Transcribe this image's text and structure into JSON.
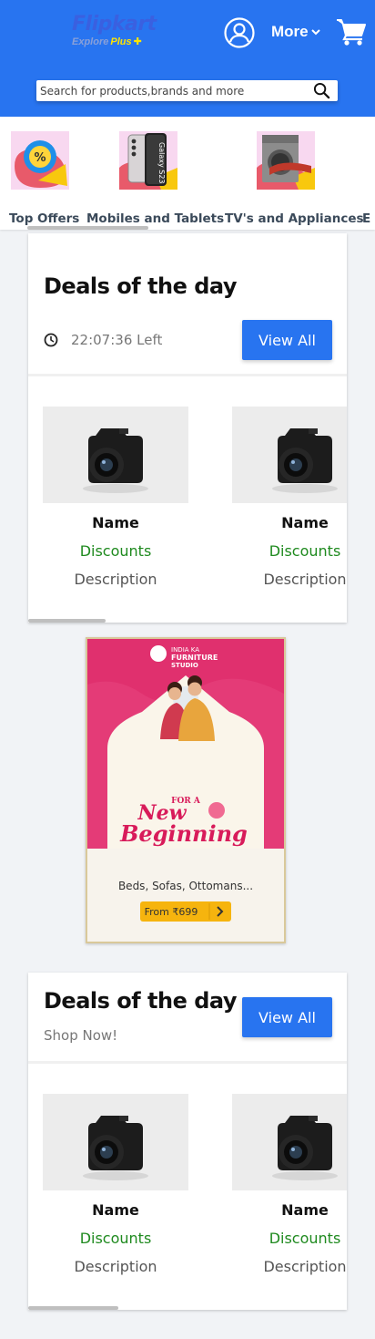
{
  "header": {
    "logo": {
      "main": "Flipkart",
      "sub_prefix": "Explore",
      "sub_plus": "Plus"
    },
    "more_label": "More",
    "search": {
      "placeholder": "Search for products,brands and more",
      "value": ""
    }
  },
  "categories": [
    {
      "label": "Top Offers",
      "icon": "offers-badge-icon"
    },
    {
      "label": "Mobiles and Tablets",
      "icon": "smartphone-galaxy-s23-icon",
      "device_text": "Galaxy S23"
    },
    {
      "label": "TV's and Appliances",
      "icon": "washing-machine-icon"
    },
    {
      "label": "E"
    }
  ],
  "deals1": {
    "title": "Deals of the day",
    "timer": "22:07:36 Left",
    "view_all": "View All",
    "products": [
      {
        "name": "Name",
        "discount": "Discounts",
        "description": "Description",
        "image": "camera-icon"
      },
      {
        "name": "Name",
        "discount": "Discounts",
        "description": "Description",
        "image": "camera-icon"
      }
    ]
  },
  "banner": {
    "brand": "INDIA KA",
    "brand2": "FURNITURE",
    "brand3": "STUDIO",
    "headline1": "FOR A",
    "headline2": "New",
    "headline3": "Beginning",
    "subtitle": "Beds, Sofas, Ottomans...",
    "cta": "From ₹699",
    "colors": {
      "top": "#e02870",
      "headline": "#d81b5a",
      "cta": "#f6b40e"
    }
  },
  "deals2": {
    "title": "Deals of the day",
    "subtitle": "Shop Now!",
    "view_all": "View All",
    "products": [
      {
        "name": "Name",
        "discount": "Discounts",
        "description": "Description",
        "image": "camera-icon"
      },
      {
        "name": "Name",
        "discount": "Discounts",
        "description": "Description",
        "image": "camera-icon"
      }
    ]
  },
  "colors": {
    "brand_blue": "#2874f0",
    "discount_green": "#1f8a1f"
  }
}
